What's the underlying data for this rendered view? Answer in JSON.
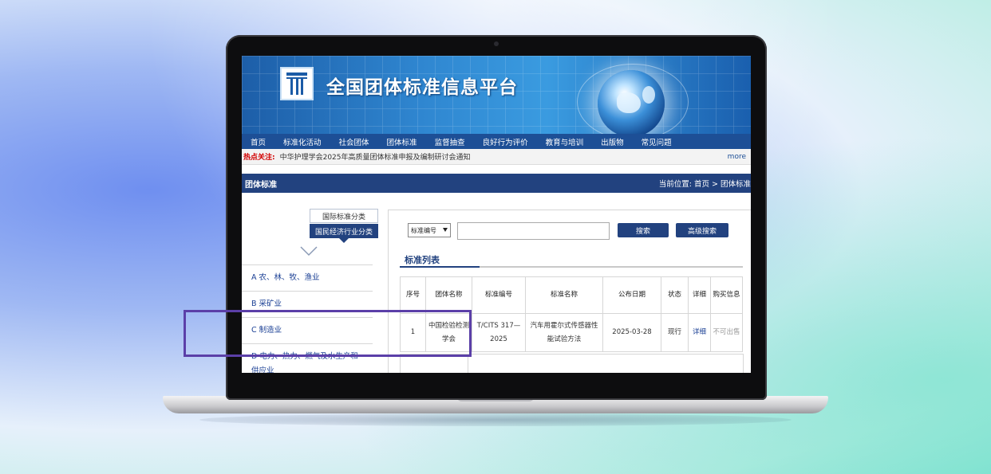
{
  "site": {
    "title": "全国团体标准信息平台"
  },
  "nav": {
    "items": [
      "首页",
      "标准化活动",
      "社会团体",
      "团体标准",
      "监督抽查",
      "良好行为评价",
      "教育与培训",
      "出版物",
      "常见问题"
    ]
  },
  "hot": {
    "label": "热点关注:",
    "text": "中华护理学会2025年高质量团体标准申报及编制研讨会通知",
    "more": "more"
  },
  "section": {
    "title": "团体标准",
    "breadcrumb": "当前位置:  首页 > 团体标准"
  },
  "sidebar": {
    "tab_international": "国际标准分类",
    "tab_national": "国民经济行业分类",
    "categories": [
      "A 农、林、牧、渔业",
      "B 采矿业",
      "C 制造业",
      "D 电力、热力、燃气及水生产和供应业"
    ]
  },
  "search": {
    "select_value": "标准编号",
    "search_label": "搜索",
    "advanced_label": "高级搜索"
  },
  "list": {
    "title": "标准列表",
    "headers": [
      "序号",
      "团体名称",
      "标准编号",
      "标准名称",
      "公布日期",
      "状态",
      "详细",
      "购买信息"
    ],
    "rows": [
      {
        "index": "1",
        "org": "中国检验检测学会",
        "code": "T/CITS 317—2025",
        "name": "汽车用霍尔式传感器性能试验方法",
        "date": "2025-03-28",
        "status": "现行",
        "detail": "详细",
        "purchase": "不可出售"
      }
    ]
  },
  "colors": {
    "nav_blue": "#1d4f96",
    "section_blue": "#22427f",
    "hot_red": "#d10000",
    "highlight_purple": "#5b3fa8"
  }
}
